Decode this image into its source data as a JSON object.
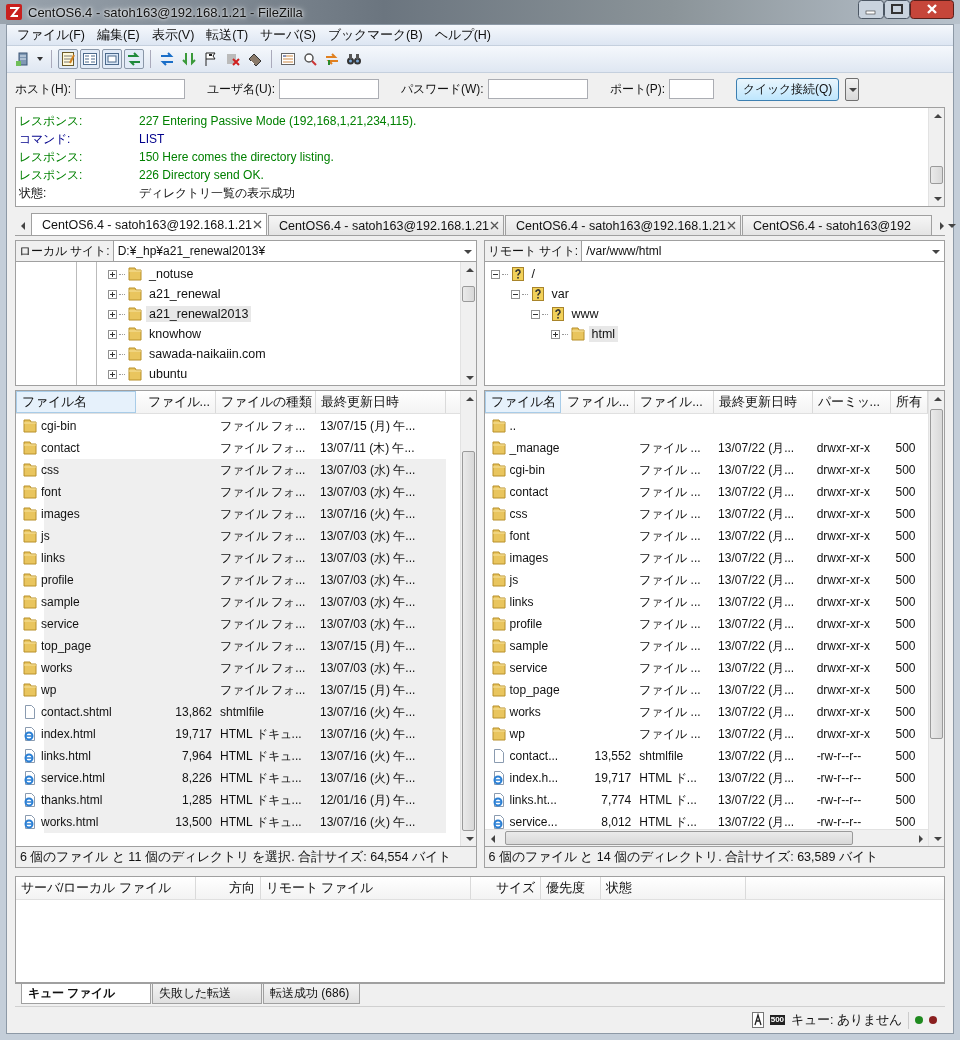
{
  "window": {
    "title": "CentOS6.4 - satoh163@192.168.1.21 - FileZilla"
  },
  "menu": [
    "ファイル(F)",
    "編集(E)",
    "表示(V)",
    "転送(T)",
    "サーバ(S)",
    "ブックマーク(B)",
    "ヘルプ(H)"
  ],
  "toolbar": [
    {
      "pressed": false
    },
    {
      "pressed": true
    },
    {
      "pressed": true
    },
    {
      "pressed": true
    },
    {
      "pressed": true
    },
    {
      "pressed": false
    },
    {
      "pressed": false
    },
    {
      "pressed": false
    },
    {
      "pressed": false
    },
    {
      "pressed": false
    },
    {
      "pressed": false
    },
    {
      "pressed": false
    },
    {
      "pressed": false
    },
    {
      "pressed": false
    }
  ],
  "quickconnect": {
    "fields": [
      {
        "label": "ホスト(H):"
      },
      {
        "label": "ユーザ名(U):"
      },
      {
        "label": "パスワード(W):"
      },
      {
        "label": "ポート(P):"
      }
    ],
    "button": "クイック接続(Q)"
  },
  "log": [
    {
      "kind": "response",
      "label": "レスポンス:",
      "message": "227 Entering Passive Mode (192,168,1,21,234,115)."
    },
    {
      "kind": "command",
      "label": "コマンド:",
      "message": "LIST"
    },
    {
      "kind": "response",
      "label": "レスポンス:",
      "message": "150 Here comes the directory listing."
    },
    {
      "kind": "response",
      "label": "レスポンス:",
      "message": "226 Directory send OK."
    },
    {
      "kind": "status",
      "label": "状態:",
      "message": "ディレクトリ一覧の表示成功"
    }
  ],
  "session_tabs": [
    {
      "label": "CentOS6.4 - satoh163@192.168.1.21",
      "selected": true,
      "closable": true
    },
    {
      "label": "CentOS6.4 - satoh163@192.168.1.21",
      "selected": false,
      "closable": true
    },
    {
      "label": "CentOS6.4 - satoh163@192.168.1.21",
      "selected": false,
      "closable": true
    },
    {
      "label": "CentOS6.4 - satoh163@192",
      "selected": false,
      "closable": false
    }
  ],
  "local": {
    "site_label": "ローカル サイト:",
    "path": "D:¥_hp¥a21_renewal2013¥",
    "tree": [
      {
        "name": "_notuse",
        "kind": "folder",
        "expanded": false,
        "selected": false
      },
      {
        "name": "a21_renewal",
        "kind": "folder",
        "expanded": false,
        "selected": false
      },
      {
        "name": "a21_renewal2013",
        "kind": "folder",
        "expanded": false,
        "selected": true
      },
      {
        "name": "knowhow",
        "kind": "folder",
        "expanded": false,
        "selected": false
      },
      {
        "name": "sawada-naikaiin.com",
        "kind": "folder",
        "expanded": false,
        "selected": false
      },
      {
        "name": "ubuntu",
        "kind": "folder",
        "expanded": false,
        "selected": false
      }
    ],
    "columns": [
      "ファイル名",
      "ファイル...",
      "ファイルの種類",
      "最終更新日時"
    ],
    "rows": [
      {
        "kind": "folder",
        "name": "cgi-bin",
        "type": "ファイル フォ...",
        "modified": "13/07/15 (月) 午...",
        "selected": false
      },
      {
        "kind": "folder",
        "name": "contact",
        "type": "ファイル フォ...",
        "modified": "13/07/11 (木) 午...",
        "selected": false
      },
      {
        "kind": "folder",
        "name": "css",
        "type": "ファイル フォ...",
        "modified": "13/07/03 (水) 午...",
        "selected": true
      },
      {
        "kind": "folder",
        "name": "font",
        "type": "ファイル フォ...",
        "modified": "13/07/03 (水) 午...",
        "selected": true
      },
      {
        "kind": "folder",
        "name": "images",
        "type": "ファイル フォ...",
        "modified": "13/07/16 (火) 午...",
        "selected": true
      },
      {
        "kind": "folder",
        "name": "js",
        "type": "ファイル フォ...",
        "modified": "13/07/03 (水) 午...",
        "selected": true
      },
      {
        "kind": "folder",
        "name": "links",
        "type": "ファイル フォ...",
        "modified": "13/07/03 (水) 午...",
        "selected": true
      },
      {
        "kind": "folder",
        "name": "profile",
        "type": "ファイル フォ...",
        "modified": "13/07/03 (水) 午...",
        "selected": true
      },
      {
        "kind": "folder",
        "name": "sample",
        "type": "ファイル フォ...",
        "modified": "13/07/03 (水) 午...",
        "selected": true
      },
      {
        "kind": "folder",
        "name": "service",
        "type": "ファイル フォ...",
        "modified": "13/07/03 (水) 午...",
        "selected": true
      },
      {
        "kind": "folder",
        "name": "top_page",
        "type": "ファイル フォ...",
        "modified": "13/07/15 (月) 午...",
        "selected": true
      },
      {
        "kind": "folder",
        "name": "works",
        "type": "ファイル フォ...",
        "modified": "13/07/03 (水) 午...",
        "selected": true
      },
      {
        "kind": "folder",
        "name": "wp",
        "type": "ファイル フォ...",
        "modified": "13/07/15 (月) 午...",
        "selected": true
      },
      {
        "kind": "file",
        "name": "contact.shtml",
        "size": "13,862",
        "type": "shtmlfile",
        "modified": "13/07/16 (火) 午...",
        "selected": true
      },
      {
        "kind": "html",
        "name": "index.html",
        "size": "19,717",
        "type": "HTML ドキュ...",
        "modified": "13/07/16 (火) 午...",
        "selected": true
      },
      {
        "kind": "html",
        "name": "links.html",
        "size": "7,964",
        "type": "HTML ドキュ...",
        "modified": "13/07/16 (火) 午...",
        "selected": true
      },
      {
        "kind": "html",
        "name": "service.html",
        "size": "8,226",
        "type": "HTML ドキュ...",
        "modified": "13/07/16 (火) 午...",
        "selected": true
      },
      {
        "kind": "html",
        "name": "thanks.html",
        "size": "1,285",
        "type": "HTML ドキュ...",
        "modified": "12/01/16 (月) 午...",
        "selected": true
      },
      {
        "kind": "html",
        "name": "works.html",
        "size": "13,500",
        "type": "HTML ドキュ...",
        "modified": "13/07/16 (火) 午...",
        "selected": true
      }
    ],
    "status": "6 個のファイル と 11 個のディレクトリ を選択. 合計サイズ: 64,554 バイト"
  },
  "remote": {
    "site_label": "リモート サイト:",
    "path": "/var/www/html",
    "tree": [
      {
        "name": "/",
        "kind": "unknown",
        "expanded": true,
        "selected": false,
        "children": [
          {
            "name": "var",
            "kind": "unknown",
            "expanded": true,
            "selected": false,
            "children": [
              {
                "name": "www",
                "kind": "unknown",
                "expanded": true,
                "selected": false,
                "children": [
                  {
                    "name": "html",
                    "kind": "folder",
                    "expanded": false,
                    "selected": true
                  }
                ]
              }
            ]
          }
        ]
      }
    ],
    "columns": [
      "ファイル名",
      "ファイル...",
      "ファイル...",
      "最終更新日時",
      "パーミッ...",
      "所有"
    ],
    "rows": [
      {
        "kind": "folder",
        "name": ".."
      },
      {
        "kind": "folder",
        "name": "_manage",
        "type": "ファイル ...",
        "modified": "13/07/22 (月...",
        "permissions": "drwxr-xr-x",
        "owner": "500"
      },
      {
        "kind": "folder",
        "name": "cgi-bin",
        "type": "ファイル ...",
        "modified": "13/07/22 (月...",
        "permissions": "drwxr-xr-x",
        "owner": "500"
      },
      {
        "kind": "folder",
        "name": "contact",
        "type": "ファイル ...",
        "modified": "13/07/22 (月...",
        "permissions": "drwxr-xr-x",
        "owner": "500"
      },
      {
        "kind": "folder",
        "name": "css",
        "type": "ファイル ...",
        "modified": "13/07/22 (月...",
        "permissions": "drwxr-xr-x",
        "owner": "500"
      },
      {
        "kind": "folder",
        "name": "font",
        "type": "ファイル ...",
        "modified": "13/07/22 (月...",
        "permissions": "drwxr-xr-x",
        "owner": "500"
      },
      {
        "kind": "folder",
        "name": "images",
        "type": "ファイル ...",
        "modified": "13/07/22 (月...",
        "permissions": "drwxr-xr-x",
        "owner": "500"
      },
      {
        "kind": "folder",
        "name": "js",
        "type": "ファイル ...",
        "modified": "13/07/22 (月...",
        "permissions": "drwxr-xr-x",
        "owner": "500"
      },
      {
        "kind": "folder",
        "name": "links",
        "type": "ファイル ...",
        "modified": "13/07/22 (月...",
        "permissions": "drwxr-xr-x",
        "owner": "500"
      },
      {
        "kind": "folder",
        "name": "profile",
        "type": "ファイル ...",
        "modified": "13/07/22 (月...",
        "permissions": "drwxr-xr-x",
        "owner": "500"
      },
      {
        "kind": "folder",
        "name": "sample",
        "type": "ファイル ...",
        "modified": "13/07/22 (月...",
        "permissions": "drwxr-xr-x",
        "owner": "500"
      },
      {
        "kind": "folder",
        "name": "service",
        "type": "ファイル ...",
        "modified": "13/07/22 (月...",
        "permissions": "drwxr-xr-x",
        "owner": "500"
      },
      {
        "kind": "folder",
        "name": "top_page",
        "type": "ファイル ...",
        "modified": "13/07/22 (月...",
        "permissions": "drwxr-xr-x",
        "owner": "500"
      },
      {
        "kind": "folder",
        "name": "works",
        "type": "ファイル ...",
        "modified": "13/07/22 (月...",
        "permissions": "drwxr-xr-x",
        "owner": "500"
      },
      {
        "kind": "folder",
        "name": "wp",
        "type": "ファイル ...",
        "modified": "13/07/22 (月...",
        "permissions": "drwxr-xr-x",
        "owner": "500"
      },
      {
        "kind": "file",
        "name": "contact...",
        "size": "13,552",
        "type": "shtmlfile",
        "modified": "13/07/22 (月...",
        "permissions": "-rw-r--r--",
        "owner": "500"
      },
      {
        "kind": "html",
        "name": "index.h...",
        "size": "19,717",
        "type": "HTML ド...",
        "modified": "13/07/22 (月...",
        "permissions": "-rw-r--r--",
        "owner": "500"
      },
      {
        "kind": "html",
        "name": "links.ht...",
        "size": "7,774",
        "type": "HTML ド...",
        "modified": "13/07/22 (月...",
        "permissions": "-rw-r--r--",
        "owner": "500"
      },
      {
        "kind": "html",
        "name": "service...",
        "size": "8,012",
        "type": "HTML ド...",
        "modified": "13/07/22 (月...",
        "permissions": "-rw-r--r--",
        "owner": "500"
      }
    ],
    "status": "6 個のファイル と 14 個のディレクトリ. 合計サイズ: 63,589 バイト"
  },
  "queue": {
    "columns": [
      "サーバ/ローカル ファイル",
      "方向",
      "リモート ファイル",
      "サイズ",
      "優先度",
      "状態"
    ],
    "tabs": [
      {
        "label": "キュー ファイル",
        "selected": true
      },
      {
        "label": "失敗した転送",
        "selected": false
      },
      {
        "label": "転送成功 (686)",
        "selected": false
      }
    ]
  },
  "status_bar": {
    "speed_badge": "500",
    "text": "キュー: ありません",
    "indicators": [
      {
        "color": "#1f8a1f"
      },
      {
        "color": "#8a1f1f"
      }
    ]
  }
}
